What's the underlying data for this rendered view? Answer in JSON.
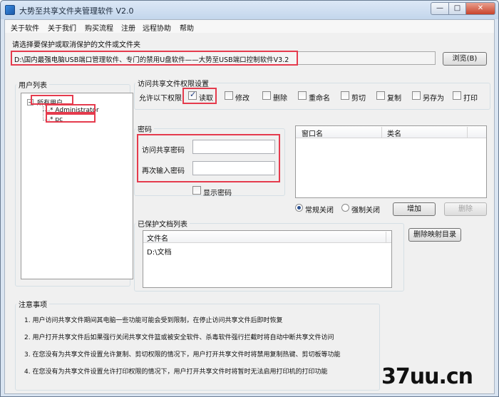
{
  "window": {
    "title": "大势至共享文件夹管理软件 V2.0",
    "minimize": "—",
    "maximize": "□",
    "close": "✕"
  },
  "menu": [
    "关于软件",
    "关于我们",
    "购买流程",
    "注册",
    "远程协助",
    "帮助"
  ],
  "path": {
    "label": "请选择要保护或取消保护的文件或文件夹",
    "value": "D:\\国内最强电脑USB端口管理软件、专门的禁用U盘软件——大势至USB端口控制软件V3.2",
    "browse_button": "浏览(B)"
  },
  "users": {
    "group_title": "用户列表",
    "root": "所有用户",
    "children": [
      "Administrator",
      "pc"
    ]
  },
  "permissions": {
    "group_title": "访问共享文件权限设置",
    "allow_label": "允许以下权限",
    "options": [
      {
        "label": "读取",
        "checked": true
      },
      {
        "label": "修改",
        "checked": false
      },
      {
        "label": "删除",
        "checked": false
      },
      {
        "label": "重命名",
        "checked": false
      },
      {
        "label": "剪切",
        "checked": false
      },
      {
        "label": "复制",
        "checked": false
      },
      {
        "label": "另存为",
        "checked": false
      },
      {
        "label": "打印",
        "checked": false
      }
    ]
  },
  "password": {
    "group_title": "密码",
    "access_label": "访问共享密码",
    "confirm_label": "再次输入密码",
    "show_label": "显示密码",
    "show_checked": false
  },
  "windows_list": {
    "columns": [
      "窗口名",
      "类名"
    ],
    "close_modes": [
      {
        "label": "常规关闭",
        "selected": true
      },
      {
        "label": "强制关闭",
        "selected": false
      }
    ],
    "add_button": "增加",
    "delete_button": "删除"
  },
  "protected": {
    "group_title": "已保护文档列表",
    "column": "文件名",
    "rows": [
      "D:\\文档"
    ],
    "delete_mapping_button": "删除映射目录"
  },
  "notes": {
    "title": "注意事项",
    "items": [
      "1. 用户访问共享文件期间其电脑一些功能可能会受到限制，在停止访问共享文件后即时恢复",
      "2. 用户打开共享文件后如果强行关闭共享文件篮或被安全软件、杀毒软件强行拦截时将自动中断共享文件访问",
      "3. 在您没有为共享文件设置允许复制、剪切权限的情况下，用户打开共享文件时将禁用复制热键、剪切板等功能",
      "4. 在您没有为共享文件设置允许打印权限的情况下，用户打开共享文件时将暂时无法启用打印机的打印功能"
    ]
  },
  "watermark": "37uu.cn"
}
